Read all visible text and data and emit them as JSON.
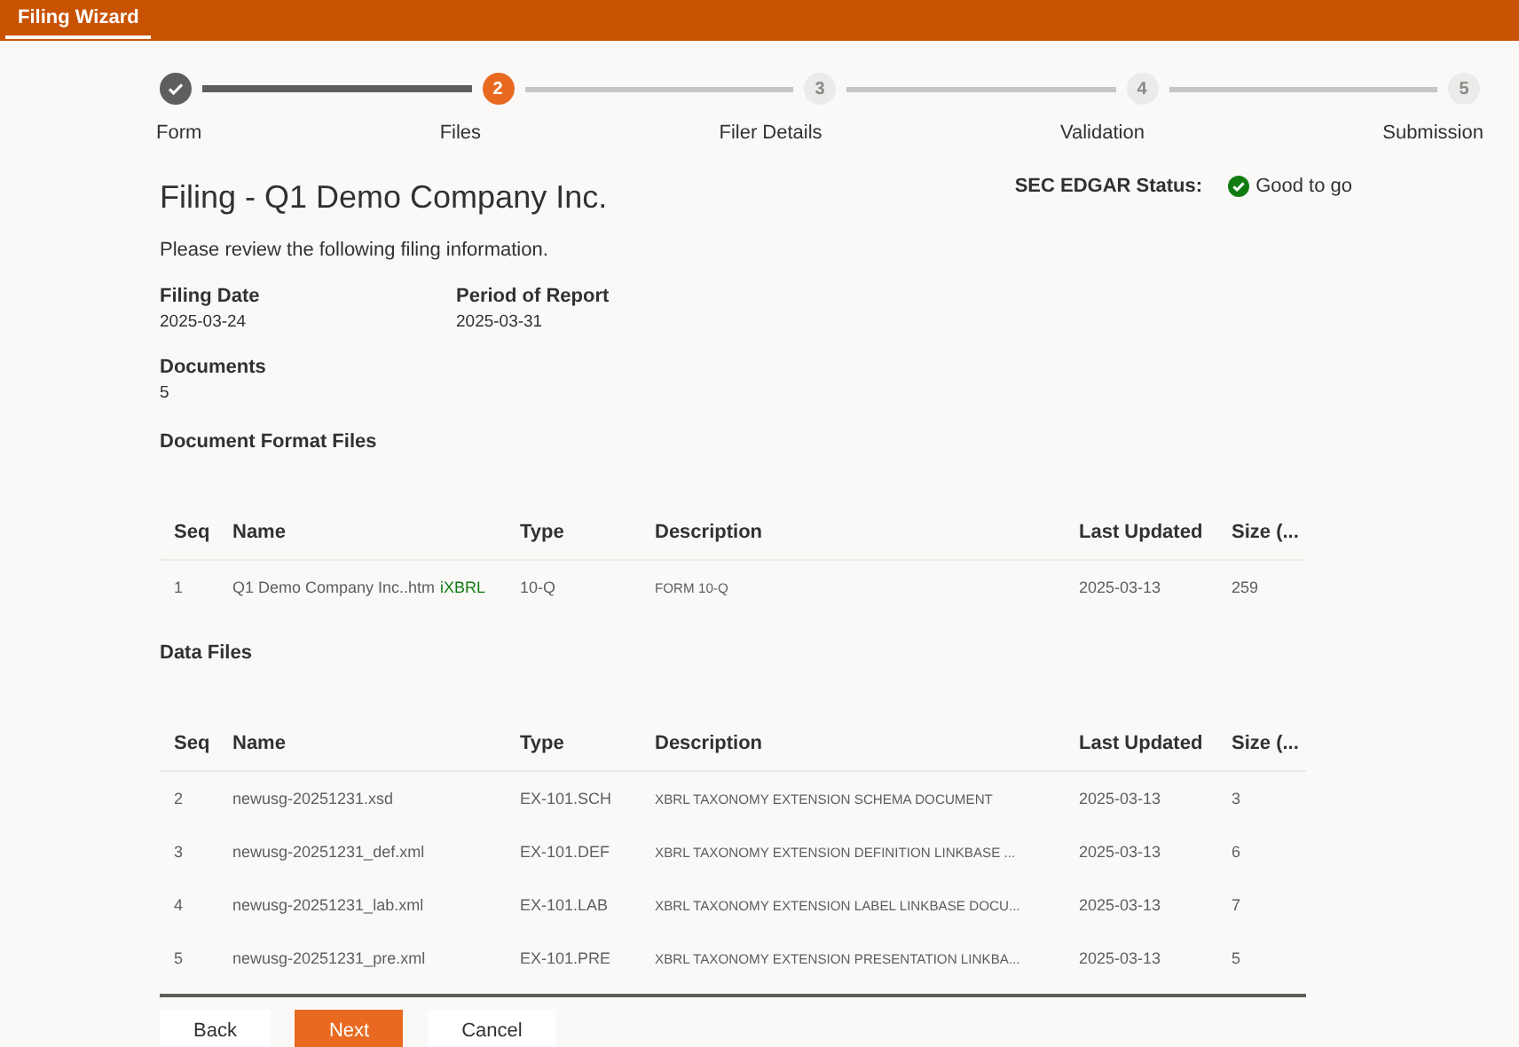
{
  "header": {
    "tab": {
      "label": "Filing Wizard",
      "selected": true
    }
  },
  "steps": [
    {
      "label": "Form",
      "kind": "done"
    },
    {
      "label": "Files",
      "number": "2",
      "kind": "current"
    },
    {
      "label": "Filer Details",
      "number": "3",
      "kind": "pending"
    },
    {
      "label": "Validation",
      "number": "4",
      "kind": "pending"
    },
    {
      "label": "Submission",
      "number": "5",
      "kind": "pending"
    }
  ],
  "title": "Filing - Q1 Demo Company Inc.",
  "edgar_status": {
    "label": "SEC EDGAR Status:",
    "value": "Good to go",
    "ok": true
  },
  "intro": "Please review the following filing information.",
  "fields": [
    {
      "label": "Filing Date",
      "value": "2025-03-24"
    },
    {
      "label": "Period of Report",
      "value": "2025-03-31"
    },
    {
      "label": "Documents",
      "value": "5"
    }
  ],
  "tables": [
    {
      "heading": "Document Format Files",
      "columns": [
        "Seq",
        "Name",
        "Type",
        "Description",
        "Last Updated",
        "Size (..."
      ],
      "rows": [
        {
          "seq": "1",
          "name": "Q1 Demo Company Inc..htm",
          "tag": "iXBRL",
          "type": "10-Q",
          "description": "FORM 10-Q",
          "updated": "2025-03-13",
          "size": "259"
        }
      ]
    },
    {
      "heading": "Data Files",
      "columns": [
        "Seq",
        "Name",
        "Type",
        "Description",
        "Last Updated",
        "Size (..."
      ],
      "rows": [
        {
          "seq": "2",
          "name": "newusg-20251231.xsd",
          "type": "EX-101.SCH",
          "description": "XBRL TAXONOMY EXTENSION SCHEMA DOCUMENT",
          "updated": "2025-03-13",
          "size": "3"
        },
        {
          "seq": "3",
          "name": "newusg-20251231_def.xml",
          "type": "EX-101.DEF",
          "description": "XBRL TAXONOMY EXTENSION DEFINITION LINKBASE ...",
          "updated": "2025-03-13",
          "size": "6"
        },
        {
          "seq": "4",
          "name": "newusg-20251231_lab.xml",
          "type": "EX-101.LAB",
          "description": "XBRL TAXONOMY EXTENSION LABEL LINKBASE DOCU...",
          "updated": "2025-03-13",
          "size": "7"
        },
        {
          "seq": "5",
          "name": "newusg-20251231_pre.xml",
          "type": "EX-101.PRE",
          "description": "XBRL TAXONOMY EXTENSION PRESENTATION LINKBA...",
          "updated": "2025-03-13",
          "size": "5"
        }
      ]
    }
  ],
  "buttons": [
    {
      "label": "Back",
      "kind": "secondary"
    },
    {
      "label": "Next",
      "kind": "primary"
    },
    {
      "label": "Cancel",
      "kind": "secondary"
    }
  ]
}
